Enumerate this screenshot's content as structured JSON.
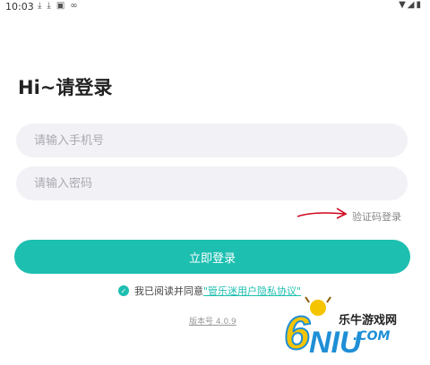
{
  "status_bar": {
    "time": "10:03",
    "left_icons": [
      "download-icon",
      "download-icon",
      "a-icon",
      "voicemail-icon"
    ],
    "right_icons": [
      "wifi-icon",
      "signal-icon",
      "battery-icon"
    ]
  },
  "login": {
    "title": "Hi~请登录",
    "phone_placeholder": "请输入手机号",
    "password_placeholder": "请输入密码",
    "sms_login": "验证码登录",
    "login_button": "立即登录",
    "agree_prefix": "我已阅读并同意",
    "policy_link": "\"管乐迷用户隐私协议\"",
    "version": "版本号 4.0.9"
  },
  "watermark": {
    "site_cn": "乐牛游戏网",
    "site_com": ".COM"
  },
  "colors": {
    "accent": "#1dbfb0",
    "field_bg": "#f2f2f6",
    "annotation_arrow": "#d0021b"
  }
}
